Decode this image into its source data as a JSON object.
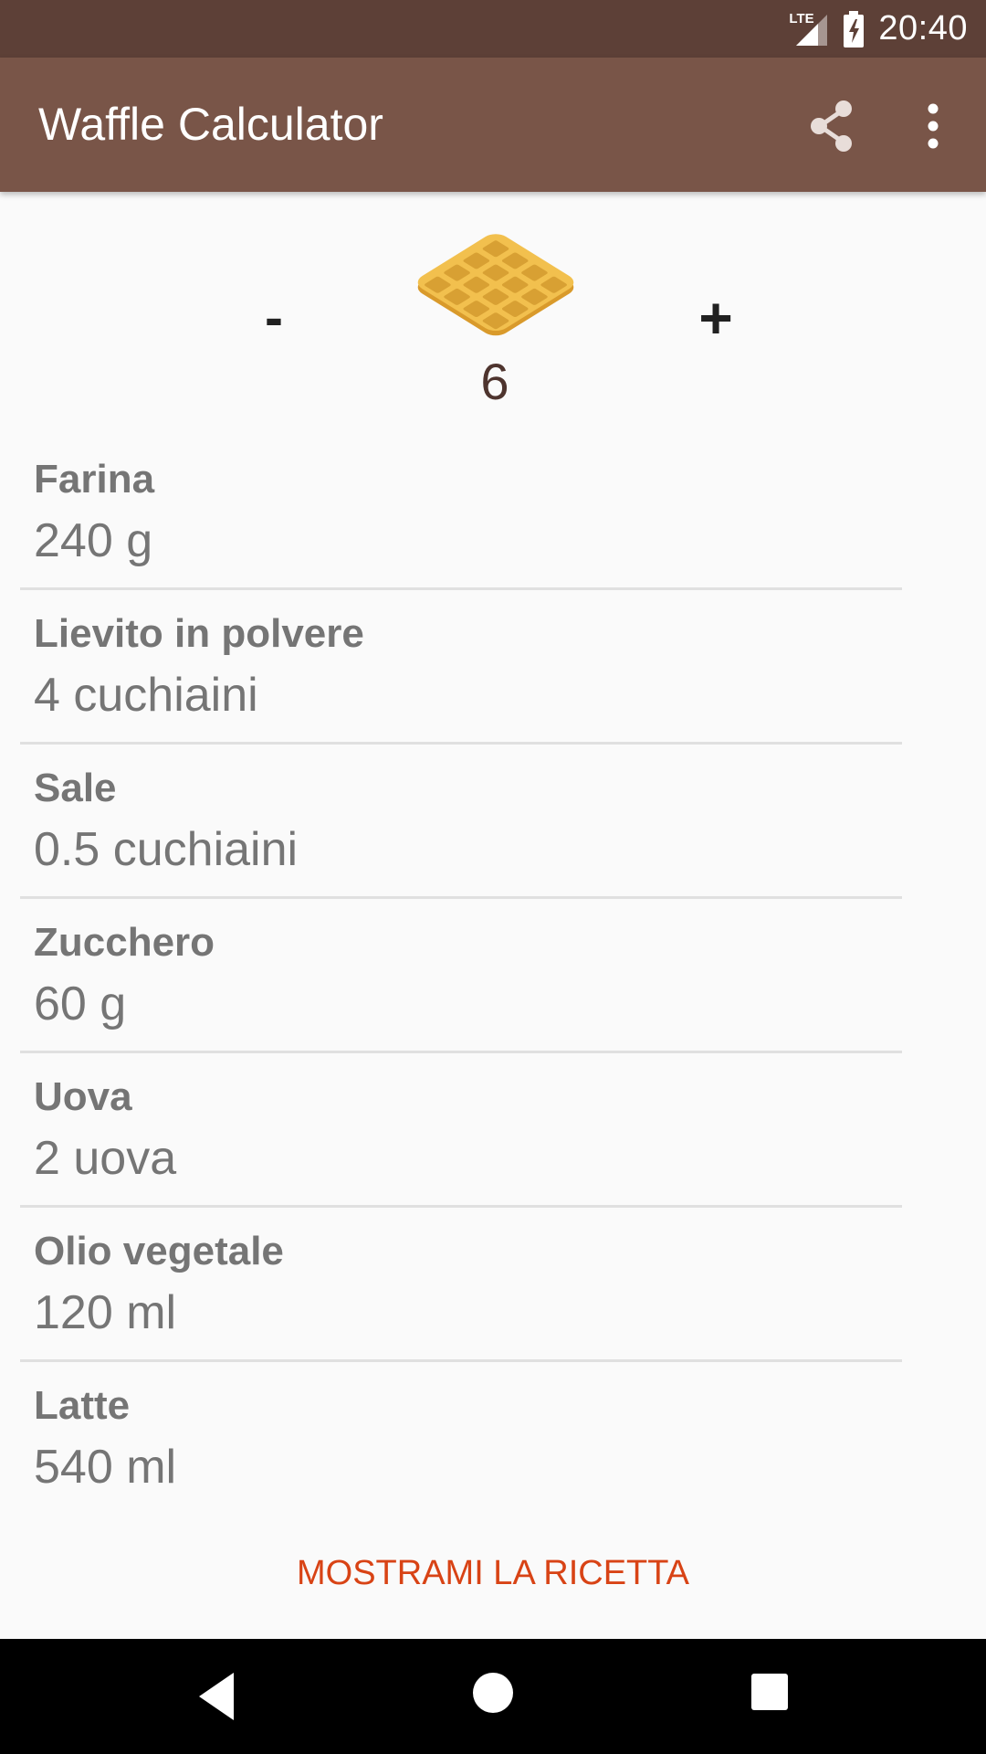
{
  "status_bar": {
    "network_label": "LTE",
    "time": "20:40"
  },
  "app_bar": {
    "title": "Waffle Calculator",
    "actions": [
      "share-icon",
      "more-vert-icon"
    ]
  },
  "counter": {
    "minus_label": "-",
    "plus_label": "+",
    "count": "6",
    "icon": "waffle-icon"
  },
  "ingredients": [
    {
      "name": "Farina",
      "amount": "240 g"
    },
    {
      "name": "Lievito in polvere",
      "amount": "4 cuchiaini"
    },
    {
      "name": "Sale",
      "amount": "0.5 cuchiaini"
    },
    {
      "name": "Zucchero",
      "amount": "60 g"
    },
    {
      "name": "Uova",
      "amount": "2 uova"
    },
    {
      "name": "Olio vegetale",
      "amount": "120 ml"
    },
    {
      "name": "Latte",
      "amount": "540 ml"
    }
  ],
  "recipe_button": "MOSTRAMI LA RICETTA",
  "colors": {
    "status_bar": "#5d4037",
    "app_bar": "#795548",
    "accent": "#d84315",
    "count_text": "#4e342e"
  }
}
